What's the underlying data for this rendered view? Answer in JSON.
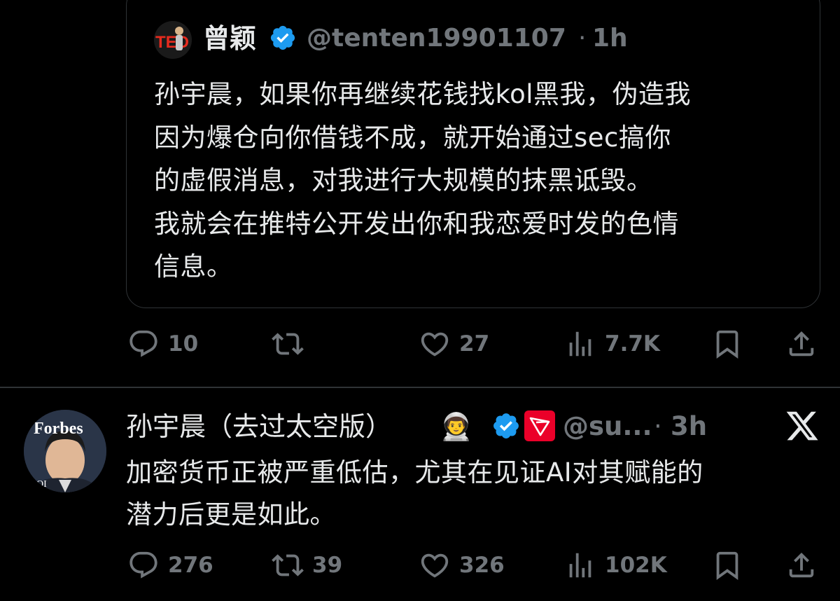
{
  "quoted_tweet": {
    "author_name": "曾颖",
    "handle": "@tenten19901107",
    "separator": "·",
    "time": "1h",
    "text": "孙宇晨，如果你再继续花钱找kol黑我，伪造我\n因为爆仓向你借钱不成，就开始通过sec搞你\n的虚假消息，对我进行大规模的抹黑诋毁。\n我就会在推特公开发出你和我恋爱时发的色情\n信息。",
    "avatar_logo_text": "TED"
  },
  "quoted_actions": {
    "replies": "10",
    "reposts": "",
    "likes": "27",
    "views": "7.7K"
  },
  "main_tweet": {
    "author_name": "孙宇晨（去过太空版）",
    "emoji": "👨‍🚀",
    "handle": "@su...",
    "separator": "·",
    "time": "3h",
    "text": "加密货币正被严重低估，尤其在见证AI对其赋能的\n潜力后更是如此。",
    "avatar_logo_text": "Forbes",
    "avatar_sub_text": "RIOI"
  },
  "main_actions": {
    "replies": "276",
    "reposts": "39",
    "likes": "326",
    "views": "102K"
  },
  "colors": {
    "background": "#000000",
    "text_primary": "#e7e9ea",
    "text_secondary": "#71767b",
    "verified_blue": "#1d9bf0",
    "tron_red": "#eb0029",
    "border": "#2f3336"
  }
}
